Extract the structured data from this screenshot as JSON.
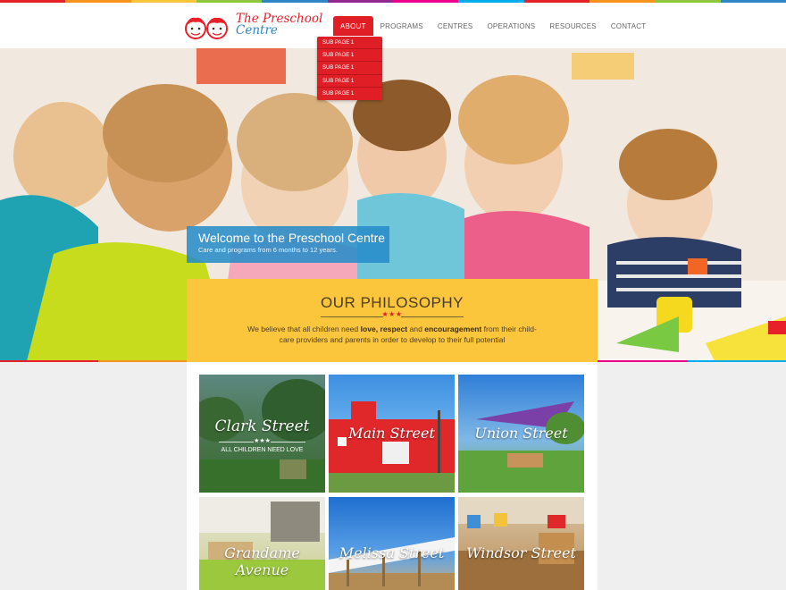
{
  "logo": {
    "line1": "The Preschool",
    "line2": "Centre"
  },
  "nav": {
    "items": [
      {
        "label": "ABOUT",
        "active": true
      },
      {
        "label": "PROGRAMS",
        "active": false
      },
      {
        "label": "CENTRES",
        "active": false
      },
      {
        "label": "OPERATIONS",
        "active": false
      },
      {
        "label": "RESOURCES",
        "active": false
      },
      {
        "label": "CONTACT",
        "active": false
      }
    ],
    "submenu": [
      "SUB PAGE 1",
      "SUB PAGE 1",
      "SUB PAGE 1",
      "SUB PAGE 1",
      "SUB PAGE 1"
    ]
  },
  "hero": {
    "welcome_title": "Welcome to the Preschool Centre",
    "welcome_sub": "Care and programs from 6 months to 12 years."
  },
  "philosophy": {
    "title": "OUR PHILOSOPHY",
    "stars": "★★★",
    "text_1": "We believe that all children need ",
    "text_bold_1": "love, respect",
    "text_2": " and ",
    "text_bold_2": "encouragement",
    "text_3": " from their child-care providers and parents in order to develop to their full potential"
  },
  "centres": [
    {
      "name": "Clark Street",
      "stars": "★★★",
      "sub": "ALL CHILDREN NEED LOVE"
    },
    {
      "name": "Main Street"
    },
    {
      "name": "Union Street"
    },
    {
      "name": "Grandame Avenue"
    },
    {
      "name": "Melissa Street"
    },
    {
      "name": "Windsor Street"
    }
  ],
  "colors": {
    "brand_red": "#e01e26",
    "brand_blue": "#2f86c7",
    "philosophy_yellow": "#fbc63c",
    "stripe": [
      "#e8202a",
      "#f7941d",
      "#fbc63c",
      "#8dc63f",
      "#2f86c7",
      "#92278f",
      "#ec008c",
      "#00aeef"
    ]
  }
}
